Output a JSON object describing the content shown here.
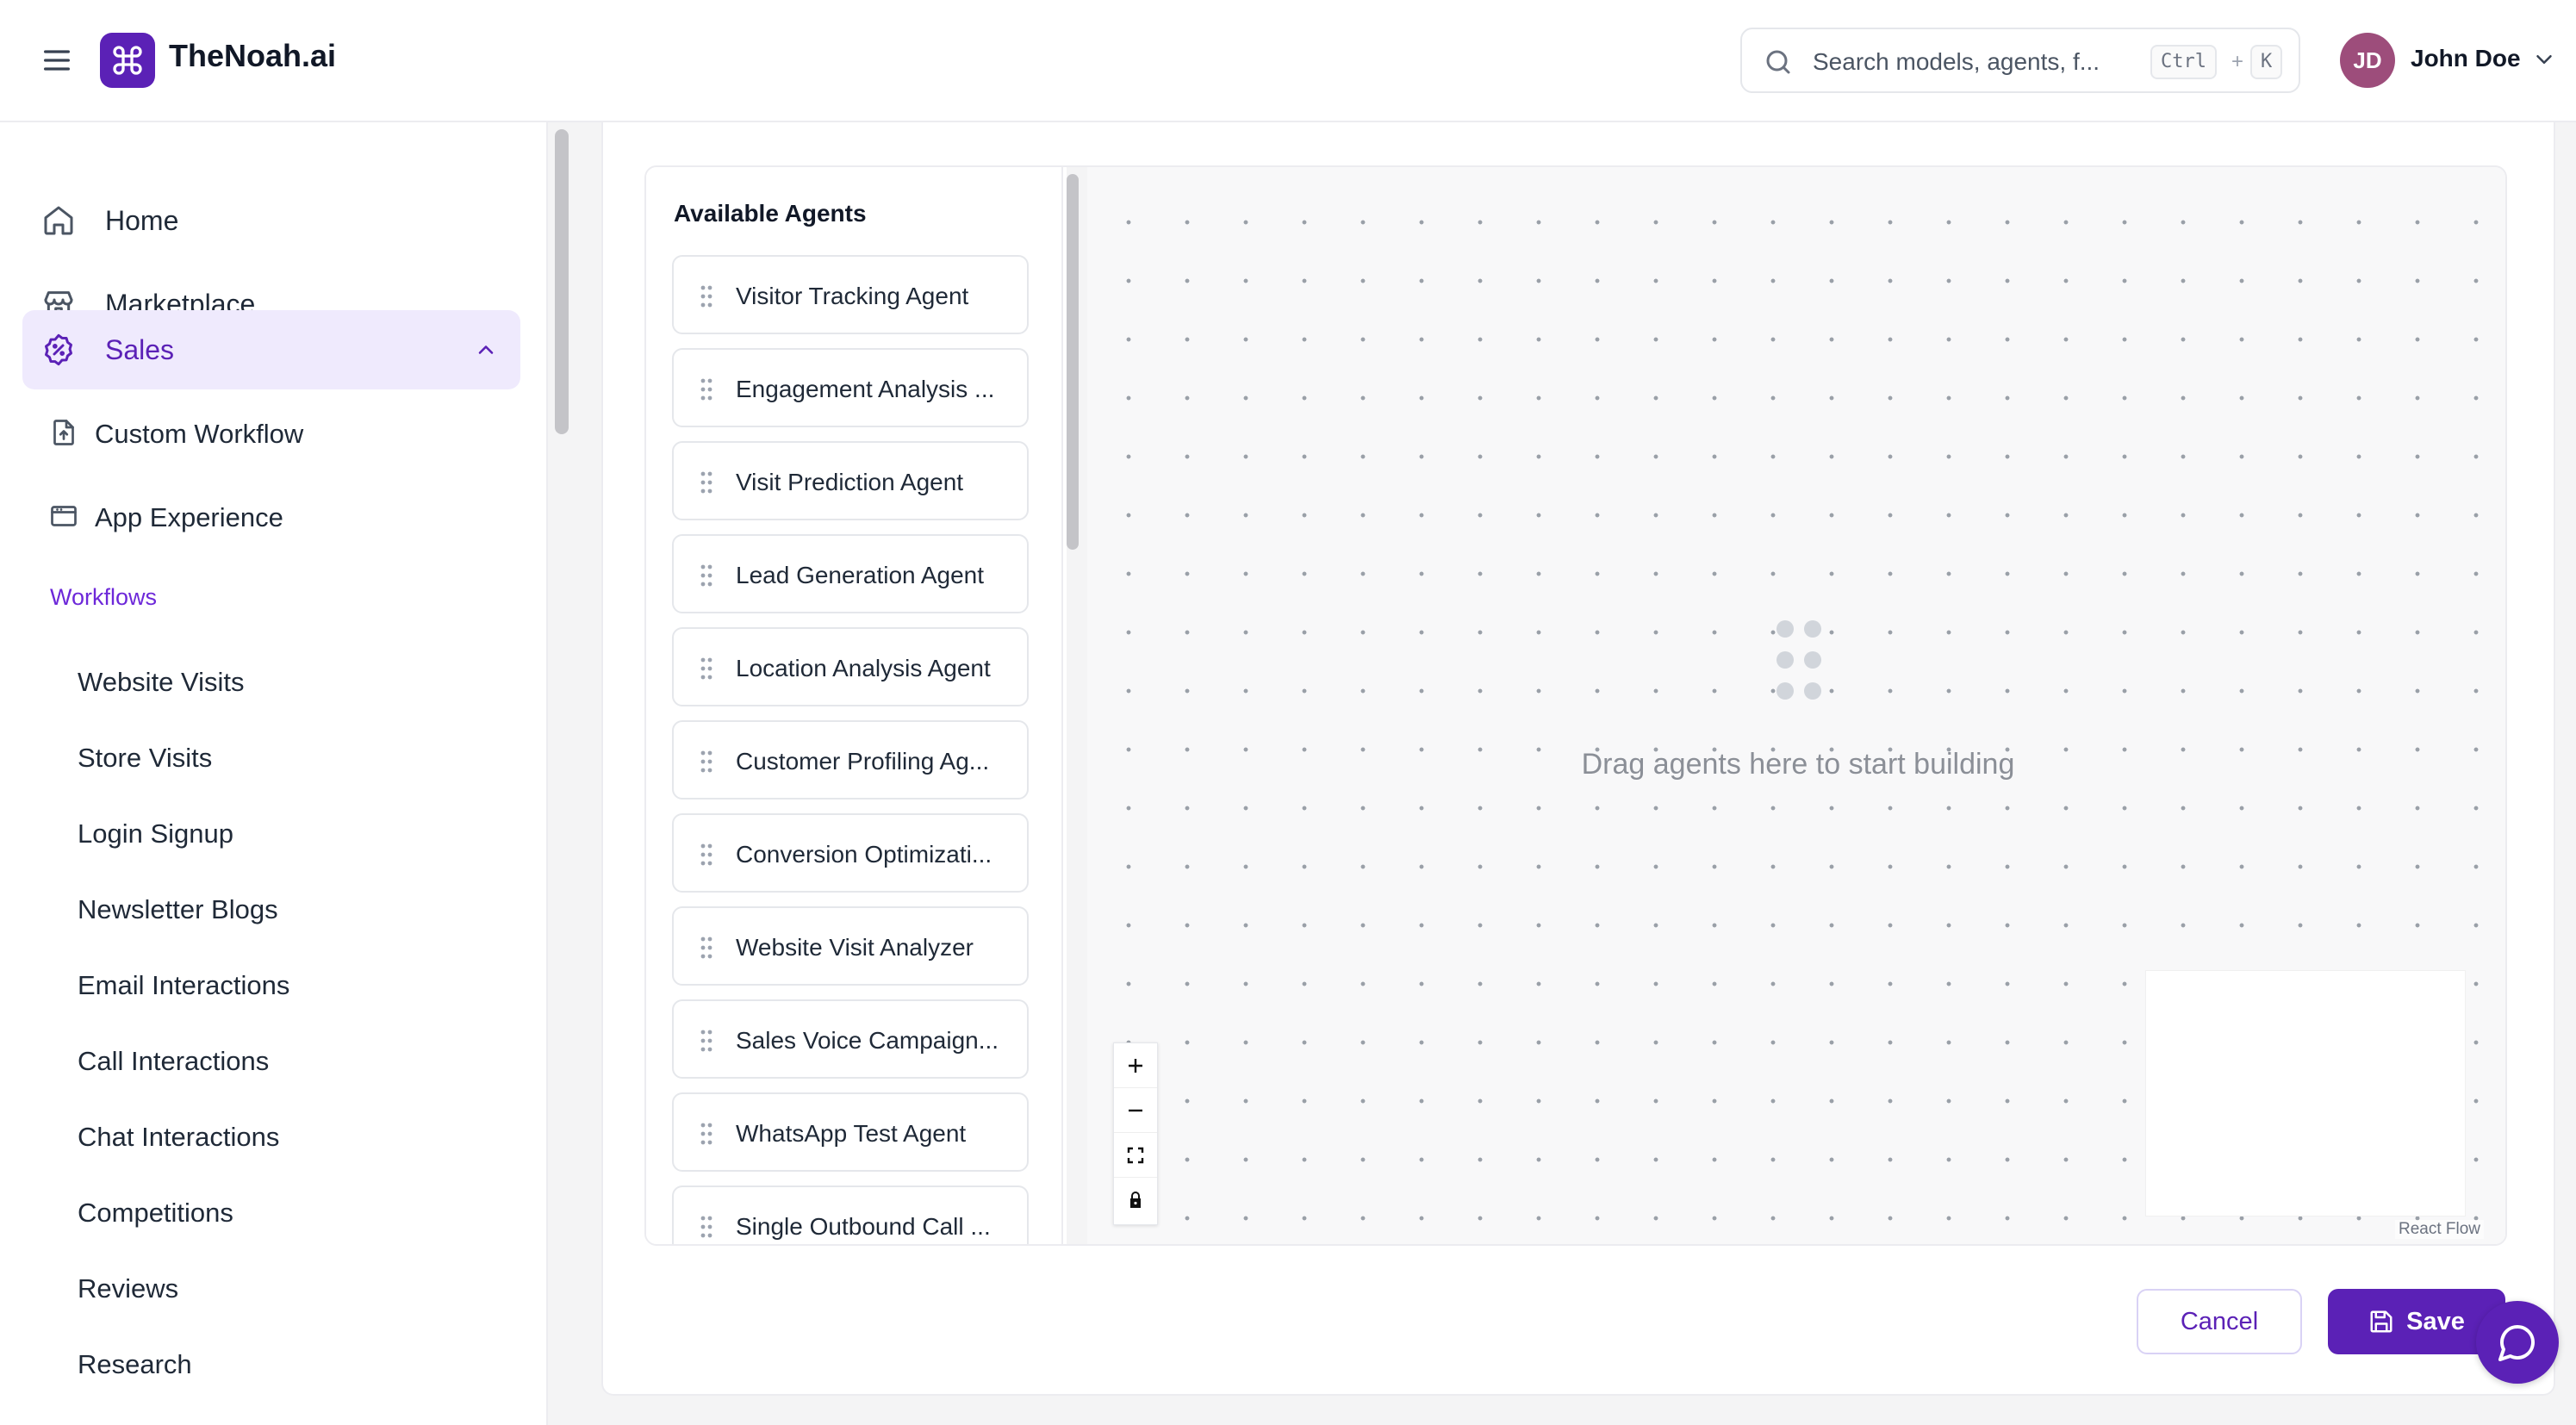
{
  "header": {
    "brand": "TheNoah.ai",
    "search_placeholder": "Search models, agents, f...",
    "shortcut_ctrl": "Ctrl",
    "shortcut_plus": "+",
    "shortcut_key": "K",
    "avatar_initials": "JD",
    "username": "John Doe"
  },
  "sidebar": {
    "nav": [
      {
        "label": "Home",
        "icon": "home-icon"
      },
      {
        "label": "Marketplace",
        "icon": "store-icon"
      },
      {
        "label": "Sales",
        "icon": "badge-percent-icon",
        "active": true,
        "expanded": true
      }
    ],
    "sales_sub": [
      {
        "label": "Custom Workflow",
        "icon": "file-upload-icon"
      },
      {
        "label": "App Experience",
        "icon": "app-window-icon"
      }
    ],
    "workflows_label": "Workflows",
    "workflows": [
      "Website Visits",
      "Store Visits",
      "Login Signup",
      "Newsletter Blogs",
      "Email Interactions",
      "Call Interactions",
      "Chat Interactions",
      "Competitions",
      "Reviews",
      "Research"
    ]
  },
  "builder": {
    "panel_title": "Available Agents",
    "agents": [
      "Visitor Tracking Agent",
      "Engagement Analysis ...",
      "Visit Prediction Agent",
      "Lead Generation Agent",
      "Location Analysis Agent",
      "Customer Profiling Ag...",
      "Conversion Optimizati...",
      "Website Visit Analyzer",
      "Sales Voice Campaign...",
      "WhatsApp Test Agent",
      "Single Outbound Call ..."
    ],
    "empty_text": "Drag agents here to start building",
    "attribution": "React Flow"
  },
  "actions": {
    "cancel": "Cancel",
    "save": "Save"
  },
  "colors": {
    "accent": "#5b21b6",
    "active_bg": "#efeafd",
    "avatar": "#9d4d7b"
  }
}
